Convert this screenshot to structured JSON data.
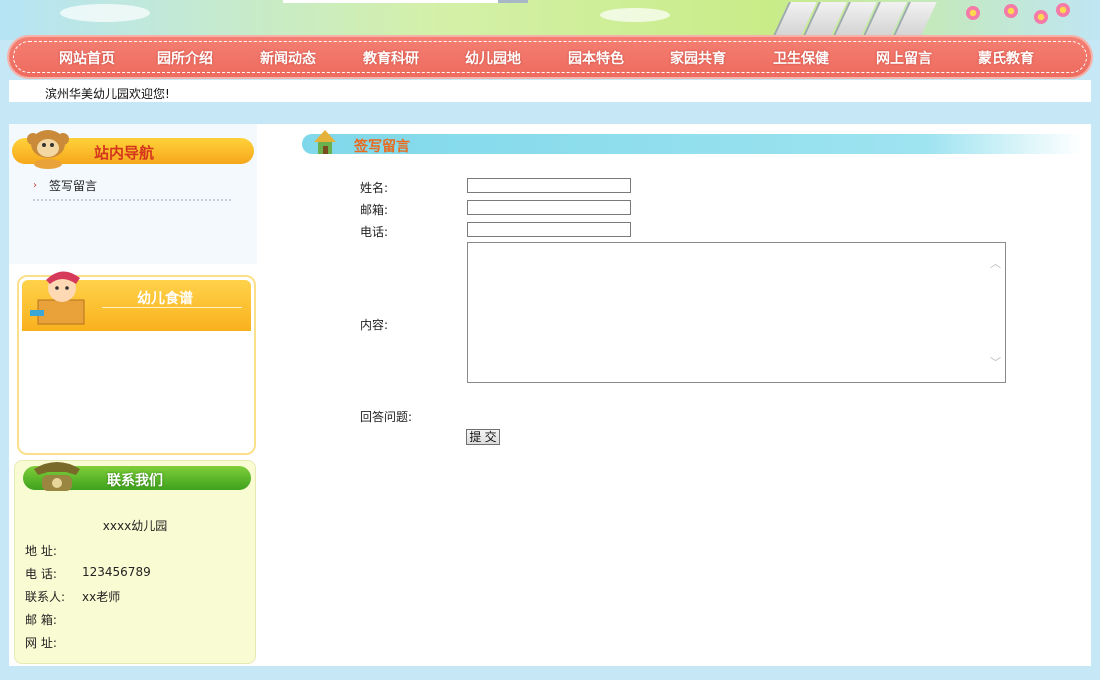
{
  "nav": {
    "items": [
      "网站首页",
      "园所介绍",
      "新闻动态",
      "教育科研",
      "幼儿园地",
      "园本特色",
      "家园共育",
      "卫生保健",
      "网上留言",
      "蒙氏教育"
    ]
  },
  "welcome": "滨州华美幼儿园欢迎您!",
  "sidebar": {
    "nav_title": "站内导航",
    "nav_items": [
      "签写留言"
    ],
    "recipe_title": "幼儿食谱",
    "contact_title": "联系我们",
    "contact": {
      "org": "xxxx幼儿园",
      "rows": [
        {
          "label": "地 址:",
          "value": ""
        },
        {
          "label": "电 话:",
          "value": "123456789"
        },
        {
          "label": "联系人:",
          "value": "xx老师"
        },
        {
          "label": "邮 箱:",
          "value": ""
        },
        {
          "label": "网 址:",
          "value": ""
        }
      ]
    }
  },
  "form": {
    "title": "签写留言",
    "name_label": "姓名:",
    "email_label": "邮箱:",
    "phone_label": "电话:",
    "content_label": "内容:",
    "question_label": "回答问题:",
    "submit_label": "提 交",
    "name_value": "",
    "email_value": "",
    "phone_value": "",
    "content_value": ""
  },
  "colors": {
    "nav_bg": "#ee6b5f",
    "background": "#c6e8f6",
    "nav_header": "#f6a71c",
    "contact_header": "#3ea11d",
    "form_header": "#7fd8ea"
  },
  "icons": [
    "mascot-monkey-icon",
    "mascot-kid-icon",
    "telephone-icon",
    "house-icon",
    "arrow-icon",
    "scroll-up-icon",
    "scroll-down-icon"
  ]
}
